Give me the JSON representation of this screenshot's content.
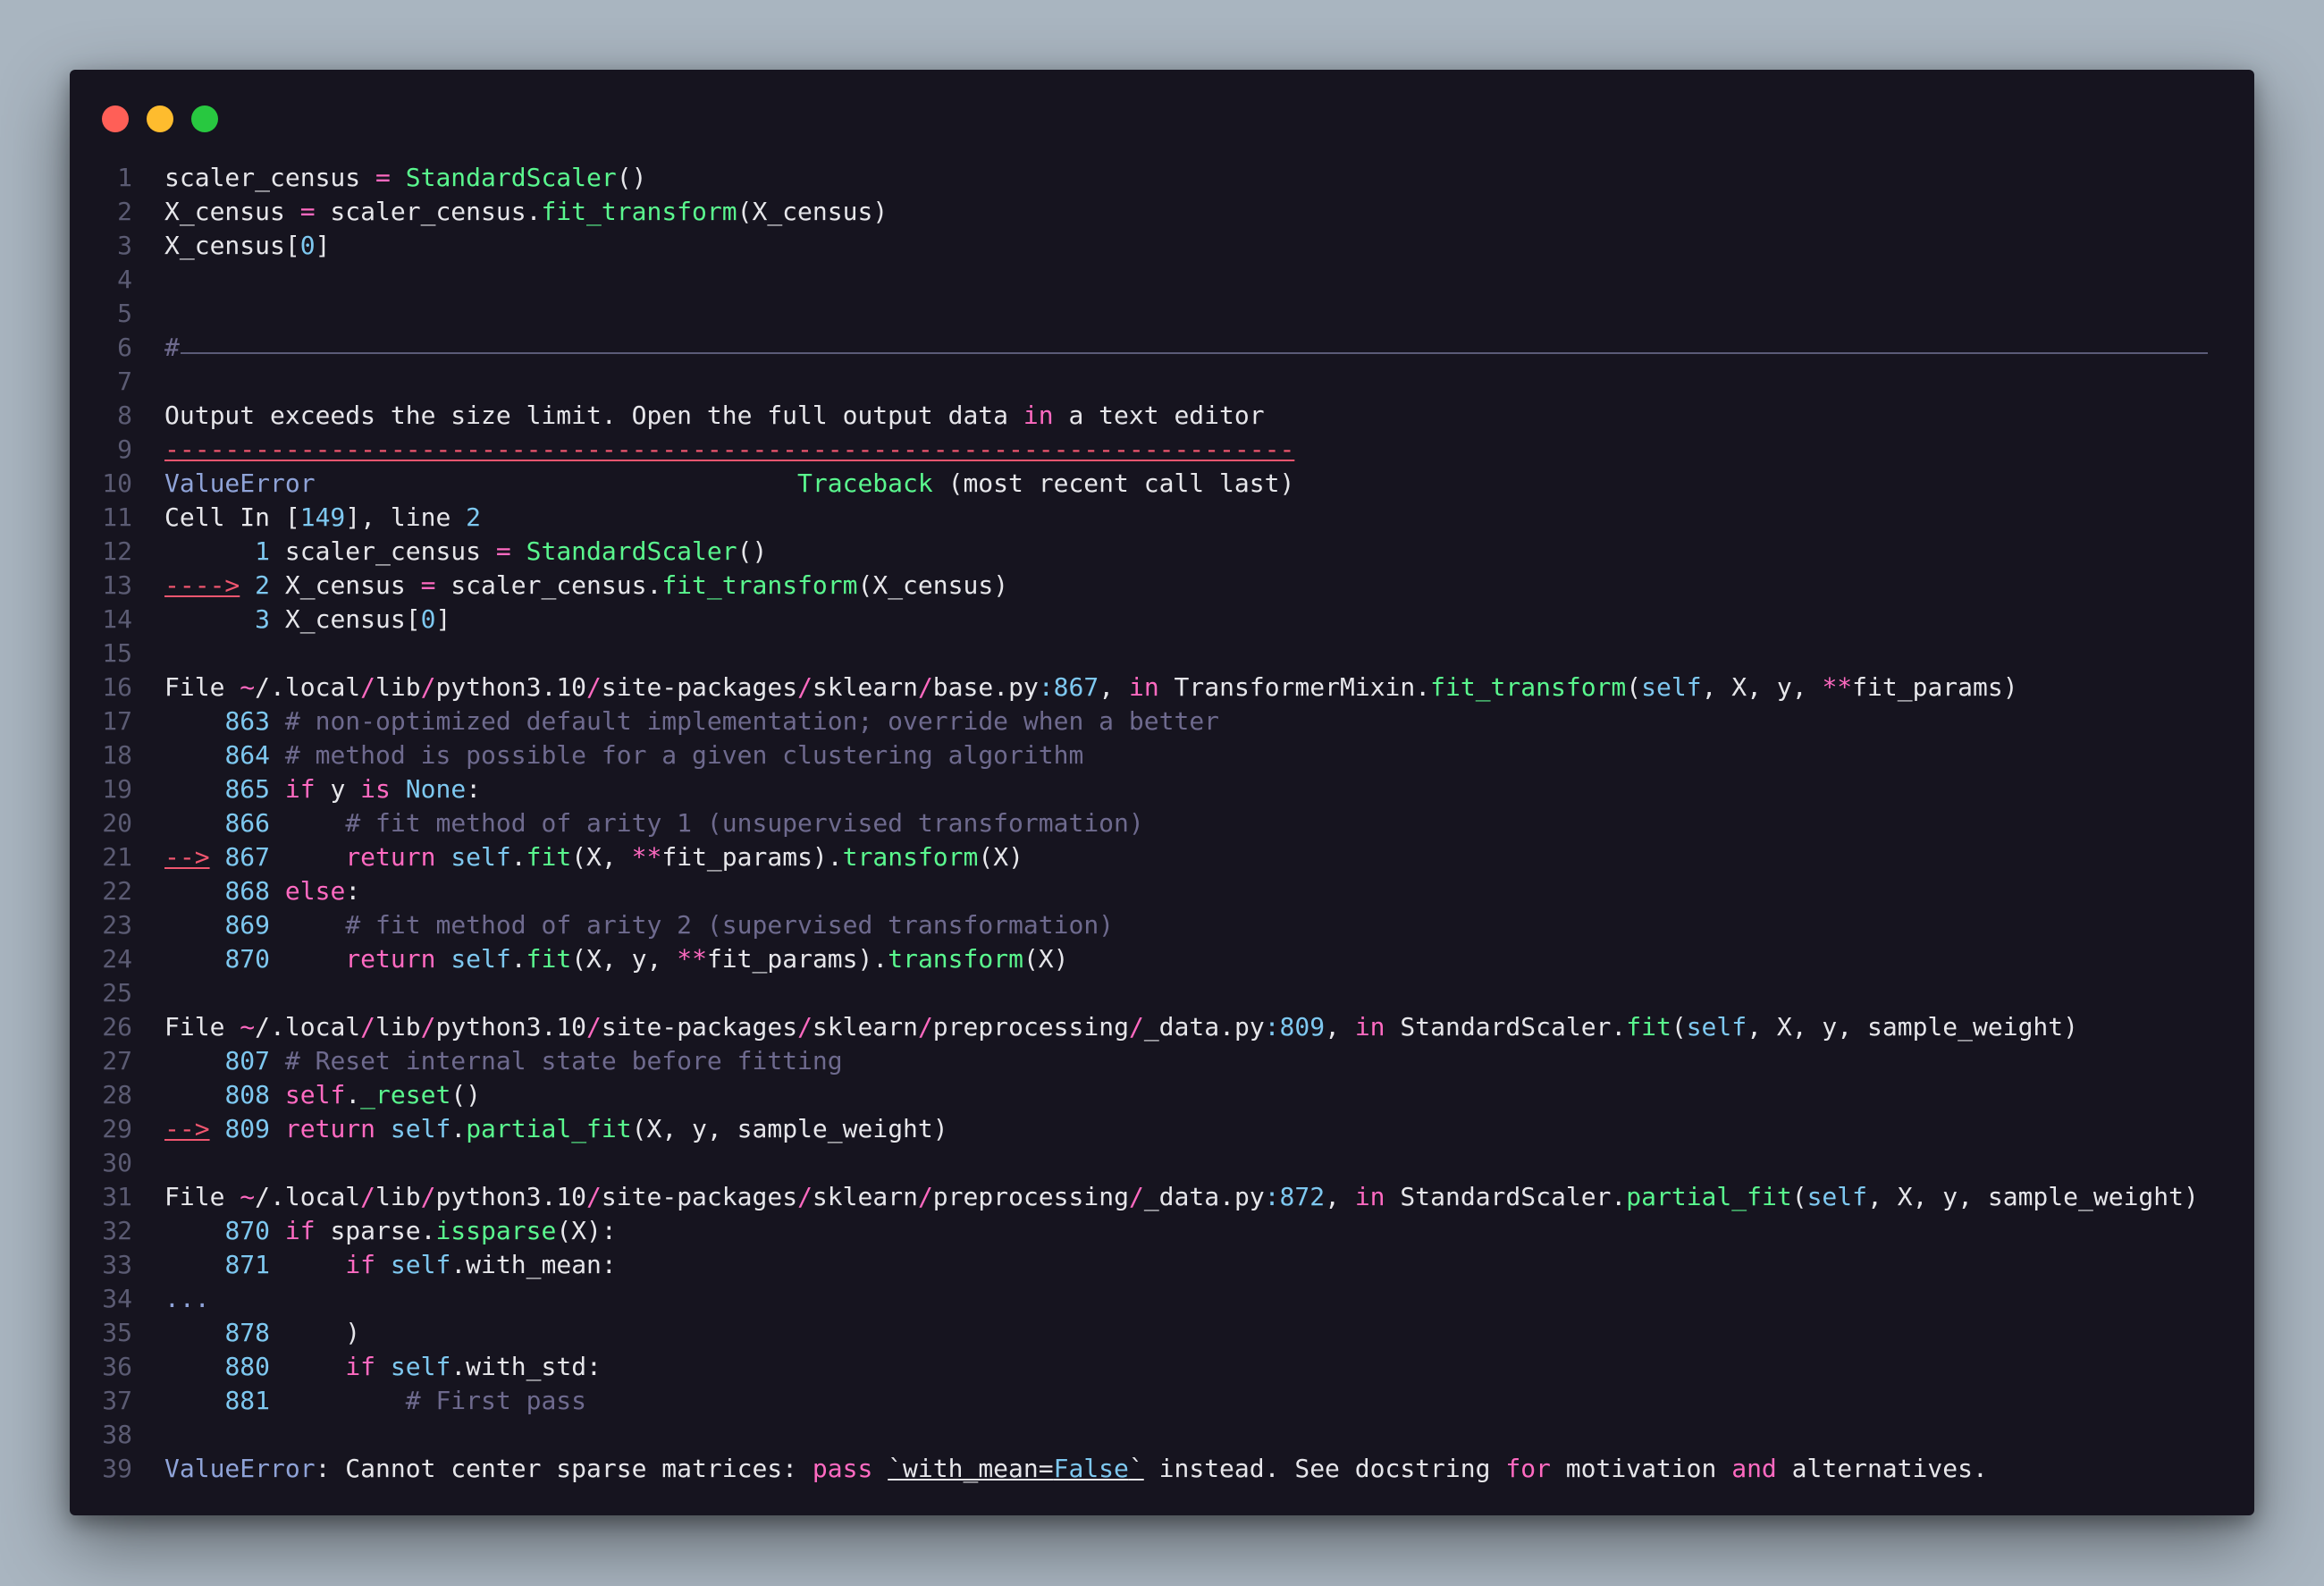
{
  "window": {
    "traffic_lights": [
      "close",
      "minimize",
      "zoom"
    ]
  },
  "colors": {
    "default": "#e6e6ea",
    "keyword": "#ff6ac1",
    "func": "#5af78e",
    "number": "#7ec8f0",
    "comment": "#6e6a8e",
    "error": "#8fa3d8",
    "red": "#f0566f"
  },
  "lines": [
    [
      [
        "scaler_census ",
        "d"
      ],
      [
        "=",
        "k"
      ],
      [
        " ",
        "d"
      ],
      [
        "StandardScaler",
        "f"
      ],
      [
        "()",
        "d"
      ]
    ],
    [
      [
        "X_census ",
        "d"
      ],
      [
        "=",
        "k"
      ],
      [
        " scaler_census.",
        "d"
      ],
      [
        "fit_transform",
        "f"
      ],
      [
        "(X_census)",
        "d"
      ]
    ],
    [
      [
        "X_census[",
        "d"
      ],
      [
        "0",
        "n"
      ],
      [
        "]",
        "d"
      ]
    ],
    [],
    [],
    [
      [
        "#",
        "c"
      ]
    ],
    [],
    [
      [
        "Output exceeds the size limit. Open the full output data ",
        "d"
      ],
      [
        "in",
        "k"
      ],
      [
        " a text editor",
        "d"
      ]
    ],
    [
      [
        "---------------------------------------------------------------------------",
        "r"
      ]
    ],
    [
      [
        "ValueError",
        "e"
      ],
      [
        "                                ",
        "d"
      ],
      [
        "Traceback",
        "f"
      ],
      [
        " (most recent call last)",
        "d"
      ]
    ],
    [
      [
        "Cell In [",
        "d"
      ],
      [
        "149",
        "n"
      ],
      [
        "], line ",
        "d"
      ],
      [
        "2",
        "n"
      ]
    ],
    [
      [
        "      ",
        "d"
      ],
      [
        "1",
        "n"
      ],
      [
        " scaler_census ",
        "d"
      ],
      [
        "=",
        "k"
      ],
      [
        " ",
        "d"
      ],
      [
        "StandardScaler",
        "f"
      ],
      [
        "()",
        "d"
      ]
    ],
    [
      [
        "---->",
        "ru"
      ],
      [
        " ",
        "d"
      ],
      [
        "2",
        "n"
      ],
      [
        " X_census ",
        "d"
      ],
      [
        "=",
        "k"
      ],
      [
        " scaler_census.",
        "d"
      ],
      [
        "fit_transform",
        "f"
      ],
      [
        "(X_census)",
        "d"
      ]
    ],
    [
      [
        "      ",
        "d"
      ],
      [
        "3",
        "n"
      ],
      [
        " X_census[",
        "d"
      ],
      [
        "0",
        "n"
      ],
      [
        "]",
        "d"
      ]
    ],
    [],
    [
      [
        "File ",
        "d"
      ],
      [
        "~",
        "k"
      ],
      [
        "/.local",
        "d"
      ],
      [
        "/",
        "k"
      ],
      [
        "lib",
        "d"
      ],
      [
        "/",
        "k"
      ],
      [
        "python3.10",
        "d"
      ],
      [
        "/",
        "k"
      ],
      [
        "site-packages",
        "d"
      ],
      [
        "/",
        "k"
      ],
      [
        "sklearn",
        "d"
      ],
      [
        "/",
        "k"
      ],
      [
        "base.py",
        "d"
      ],
      [
        ":867",
        "n"
      ],
      [
        ", ",
        "d"
      ],
      [
        "in",
        "k"
      ],
      [
        " TransformerMixin.",
        "d"
      ],
      [
        "fit_transform",
        "f"
      ],
      [
        "(",
        "d"
      ],
      [
        "self",
        "n"
      ],
      [
        ", X, y, ",
        "d"
      ],
      [
        "**",
        "k"
      ],
      [
        "fit_params)",
        "d"
      ]
    ],
    [
      [
        "    ",
        "d"
      ],
      [
        "863",
        "n"
      ],
      [
        " ",
        "d"
      ],
      [
        "# non-optimized default implementation; override when a better",
        "c"
      ]
    ],
    [
      [
        "    ",
        "d"
      ],
      [
        "864",
        "n"
      ],
      [
        " ",
        "d"
      ],
      [
        "# method is possible for a given clustering algorithm",
        "c"
      ]
    ],
    [
      [
        "    ",
        "d"
      ],
      [
        "865",
        "n"
      ],
      [
        " ",
        "d"
      ],
      [
        "if",
        "k"
      ],
      [
        " y ",
        "d"
      ],
      [
        "is",
        "k"
      ],
      [
        " ",
        "d"
      ],
      [
        "None",
        "n"
      ],
      [
        ":",
        "d"
      ]
    ],
    [
      [
        "    ",
        "d"
      ],
      [
        "866",
        "n"
      ],
      [
        "     ",
        "d"
      ],
      [
        "# fit method of arity 1 (unsupervised transformation)",
        "c"
      ]
    ],
    [
      [
        "-->",
        "ru"
      ],
      [
        " ",
        "d"
      ],
      [
        "867",
        "n"
      ],
      [
        "     ",
        "d"
      ],
      [
        "return",
        "k"
      ],
      [
        " ",
        "d"
      ],
      [
        "self",
        "n"
      ],
      [
        ".",
        "d"
      ],
      [
        "fit",
        "f"
      ],
      [
        "(X, ",
        "d"
      ],
      [
        "**",
        "k"
      ],
      [
        "fit_params).",
        "d"
      ],
      [
        "transform",
        "f"
      ],
      [
        "(X)",
        "d"
      ]
    ],
    [
      [
        "    ",
        "d"
      ],
      [
        "868",
        "n"
      ],
      [
        " ",
        "d"
      ],
      [
        "else",
        "k"
      ],
      [
        ":",
        "d"
      ]
    ],
    [
      [
        "    ",
        "d"
      ],
      [
        "869",
        "n"
      ],
      [
        "     ",
        "d"
      ],
      [
        "# fit method of arity 2 (supervised transformation)",
        "c"
      ]
    ],
    [
      [
        "    ",
        "d"
      ],
      [
        "870",
        "n"
      ],
      [
        "     ",
        "d"
      ],
      [
        "return",
        "k"
      ],
      [
        " ",
        "d"
      ],
      [
        "self",
        "n"
      ],
      [
        ".",
        "d"
      ],
      [
        "fit",
        "f"
      ],
      [
        "(X, y, ",
        "d"
      ],
      [
        "**",
        "k"
      ],
      [
        "fit_params).",
        "d"
      ],
      [
        "transform",
        "f"
      ],
      [
        "(X)",
        "d"
      ]
    ],
    [],
    [
      [
        "File ",
        "d"
      ],
      [
        "~",
        "k"
      ],
      [
        "/.local",
        "d"
      ],
      [
        "/",
        "k"
      ],
      [
        "lib",
        "d"
      ],
      [
        "/",
        "k"
      ],
      [
        "python3.10",
        "d"
      ],
      [
        "/",
        "k"
      ],
      [
        "site-packages",
        "d"
      ],
      [
        "/",
        "k"
      ],
      [
        "sklearn",
        "d"
      ],
      [
        "/",
        "k"
      ],
      [
        "preprocessing",
        "d"
      ],
      [
        "/",
        "k"
      ],
      [
        "_data.py",
        "d"
      ],
      [
        ":809",
        "n"
      ],
      [
        ", ",
        "d"
      ],
      [
        "in",
        "k"
      ],
      [
        " StandardScaler.",
        "d"
      ],
      [
        "fit",
        "f"
      ],
      [
        "(",
        "d"
      ],
      [
        "self",
        "n"
      ],
      [
        ", X, y, sample_weight)",
        "d"
      ]
    ],
    [
      [
        "    ",
        "d"
      ],
      [
        "807",
        "n"
      ],
      [
        " ",
        "d"
      ],
      [
        "# Reset internal state before fitting",
        "c"
      ]
    ],
    [
      [
        "    ",
        "d"
      ],
      [
        "808",
        "n"
      ],
      [
        " ",
        "d"
      ],
      [
        "self",
        "k"
      ],
      [
        ".",
        "d"
      ],
      [
        "_reset",
        "f"
      ],
      [
        "()",
        "d"
      ]
    ],
    [
      [
        "-->",
        "ru"
      ],
      [
        " ",
        "d"
      ],
      [
        "809",
        "n"
      ],
      [
        " ",
        "d"
      ],
      [
        "return",
        "k"
      ],
      [
        " ",
        "d"
      ],
      [
        "self",
        "n"
      ],
      [
        ".",
        "d"
      ],
      [
        "partial_fit",
        "f"
      ],
      [
        "(X, y, sample_weight)",
        "d"
      ]
    ],
    [],
    [
      [
        "File ",
        "d"
      ],
      [
        "~",
        "k"
      ],
      [
        "/.local",
        "d"
      ],
      [
        "/",
        "k"
      ],
      [
        "lib",
        "d"
      ],
      [
        "/",
        "k"
      ],
      [
        "python3.10",
        "d"
      ],
      [
        "/",
        "k"
      ],
      [
        "site-packages",
        "d"
      ],
      [
        "/",
        "k"
      ],
      [
        "sklearn",
        "d"
      ],
      [
        "/",
        "k"
      ],
      [
        "preprocessing",
        "d"
      ],
      [
        "/",
        "k"
      ],
      [
        "_data.py",
        "d"
      ],
      [
        ":872",
        "n"
      ],
      [
        ", ",
        "d"
      ],
      [
        "in",
        "k"
      ],
      [
        " StandardScaler.",
        "d"
      ],
      [
        "partial_fit",
        "f"
      ],
      [
        "(",
        "d"
      ],
      [
        "self",
        "n"
      ],
      [
        ", X, y, sample_weight)",
        "d"
      ]
    ],
    [
      [
        "    ",
        "d"
      ],
      [
        "870",
        "n"
      ],
      [
        " ",
        "d"
      ],
      [
        "if",
        "k"
      ],
      [
        " sparse.",
        "d"
      ],
      [
        "issparse",
        "f"
      ],
      [
        "(X):",
        "d"
      ]
    ],
    [
      [
        "    ",
        "d"
      ],
      [
        "871",
        "n"
      ],
      [
        "     ",
        "d"
      ],
      [
        "if",
        "k"
      ],
      [
        " ",
        "d"
      ],
      [
        "self",
        "n"
      ],
      [
        ".with_mean:",
        "d"
      ]
    ],
    [
      [
        "...",
        "e"
      ]
    ],
    [
      [
        "    ",
        "d"
      ],
      [
        "878",
        "n"
      ],
      [
        "     )",
        "d"
      ]
    ],
    [
      [
        "    ",
        "d"
      ],
      [
        "880",
        "n"
      ],
      [
        "     ",
        "d"
      ],
      [
        "if",
        "k"
      ],
      [
        " ",
        "d"
      ],
      [
        "self",
        "n"
      ],
      [
        ".with_std:",
        "d"
      ]
    ],
    [
      [
        "    ",
        "d"
      ],
      [
        "881",
        "n"
      ],
      [
        "         ",
        "d"
      ],
      [
        "# First pass",
        "c"
      ]
    ],
    [],
    [
      [
        "ValueError",
        "e"
      ],
      [
        ": Cannot center sparse matrices: ",
        "d"
      ],
      [
        "pass",
        "k"
      ],
      [
        " ",
        "d"
      ],
      [
        "`with_mean=",
        "du"
      ],
      [
        "False",
        "nu"
      ],
      [
        "`",
        "du"
      ],
      [
        " instead. See docstring ",
        "d"
      ],
      [
        "for",
        "k"
      ],
      [
        " motivation ",
        "d"
      ],
      [
        "and",
        "k"
      ],
      [
        " alternatives.",
        "d"
      ]
    ]
  ]
}
